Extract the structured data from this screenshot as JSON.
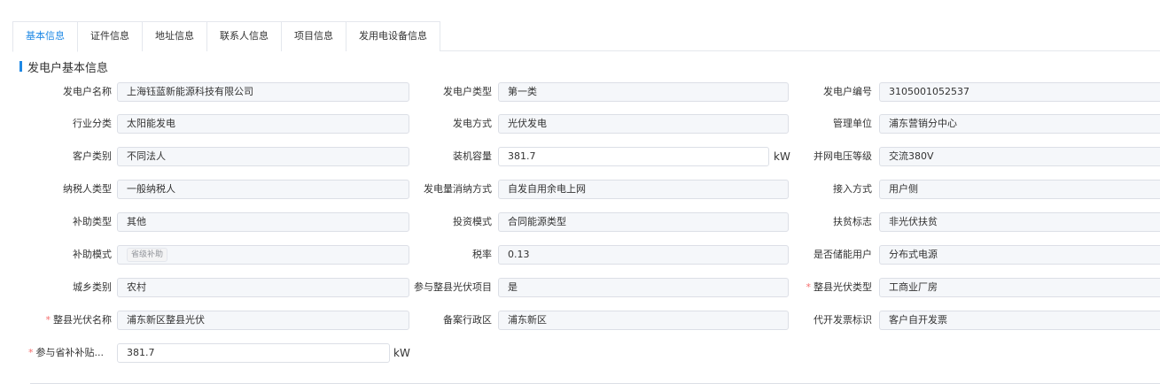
{
  "tabs": [
    {
      "label": "基本信息",
      "active": true
    },
    {
      "label": "证件信息",
      "active": false
    },
    {
      "label": "地址信息",
      "active": false
    },
    {
      "label": "联系人信息",
      "active": false
    },
    {
      "label": "项目信息",
      "active": false
    },
    {
      "label": "发用电设备信息",
      "active": false
    }
  ],
  "section": {
    "title": "发电户基本信息"
  },
  "colors": {
    "accent": "#1e88e5",
    "required": "#f56c6c"
  },
  "form": {
    "r1": {
      "a_label": "发电户名称",
      "a_value": "上海钰蓝新能源科技有限公司",
      "b_label": "发电户类型",
      "b_value": "第一类",
      "c_label": "发电户编号",
      "c_value": "3105001052537"
    },
    "r2": {
      "a_label": "行业分类",
      "a_value": "太阳能发电",
      "b_label": "发电方式",
      "b_value": "光伏发电",
      "c_label": "管理单位",
      "c_value": "浦东营销分中心"
    },
    "r3": {
      "a_label": "客户类别",
      "a_value": "不同法人",
      "b_label": "装机容量",
      "b_value": "381.7",
      "b_unit": "kW",
      "c_label": "并网电压等级",
      "c_value": "交流380V"
    },
    "r4": {
      "a_label": "纳税人类型",
      "a_value": "一般纳税人",
      "b_label": "发电量消纳方式",
      "b_value": "自发自用余电上网",
      "c_label": "接入方式",
      "c_value": "用户侧"
    },
    "r5": {
      "a_label": "补助类型",
      "a_value": "其他",
      "b_label": "投资模式",
      "b_value": "合同能源类型",
      "c_label": "扶贫标志",
      "c_value": "非光伏扶贫"
    },
    "r6": {
      "a_label": "补助模式",
      "a_tag": "省级补助",
      "b_label": "税率",
      "b_value": "0.13",
      "c_label": "是否储能用户",
      "c_value": "分布式电源"
    },
    "r7": {
      "a_label": "城乡类别",
      "a_value": "农村",
      "b_label": "参与整县光伏项目",
      "b_value": "是",
      "c_label": "整县光伏类型",
      "c_value": "工商业厂房",
      "c_required": true
    },
    "r8": {
      "a_label": "整县光伏名称",
      "a_value": "浦东新区整县光伏",
      "a_required": true,
      "b_label": "备案行政区",
      "b_value": "浦东新区",
      "c_label": "代开发票标识",
      "c_value": "客户自开发票"
    },
    "r9": {
      "a_label": "参与省补补贴...",
      "a_value": "381.7",
      "a_unit": "kW",
      "a_required": true
    }
  }
}
